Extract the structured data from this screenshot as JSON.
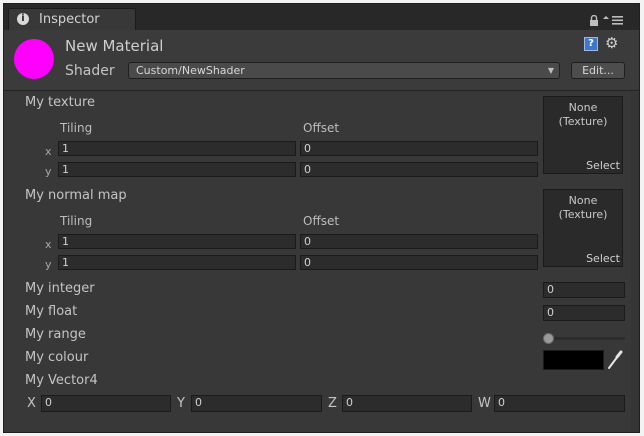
{
  "tab": {
    "title": "Inspector",
    "info_glyph": "i"
  },
  "header": {
    "material_name": "New Material",
    "material_color": "#ff00ff",
    "shader_label": "Shader",
    "shader_value": "Custom/NewShader",
    "edit_label": "Edit...",
    "help_glyph": "?",
    "gear_glyph": "⚙"
  },
  "common": {
    "tiling": "Tiling",
    "offset": "Offset",
    "x": "x",
    "y": "y",
    "select": "Select",
    "none_texture": "None\n(Texture)"
  },
  "properties": {
    "texture": {
      "label": "My texture",
      "tiling": {
        "x": "1",
        "y": "1"
      },
      "offset": {
        "x": "0",
        "y": "0"
      }
    },
    "normal_map": {
      "label": "My normal map",
      "tiling": {
        "x": "1",
        "y": "1"
      },
      "offset": {
        "x": "0",
        "y": "0"
      }
    },
    "integer": {
      "label": "My integer",
      "value": "0"
    },
    "float": {
      "label": "My float",
      "value": "0"
    },
    "range": {
      "label": "My range",
      "value": 0
    },
    "colour": {
      "label": "My colour",
      "value": "#000000"
    },
    "vector4": {
      "label": "My Vector4",
      "x_label": "X",
      "x": "0",
      "y_label": "Y",
      "y": "0",
      "z_label": "Z",
      "z": "0",
      "w_label": "W",
      "w": "0"
    }
  },
  "colors": {
    "panel_bg": "#383838",
    "field_bg": "#2c2c2c",
    "text": "#c4c4c4"
  }
}
